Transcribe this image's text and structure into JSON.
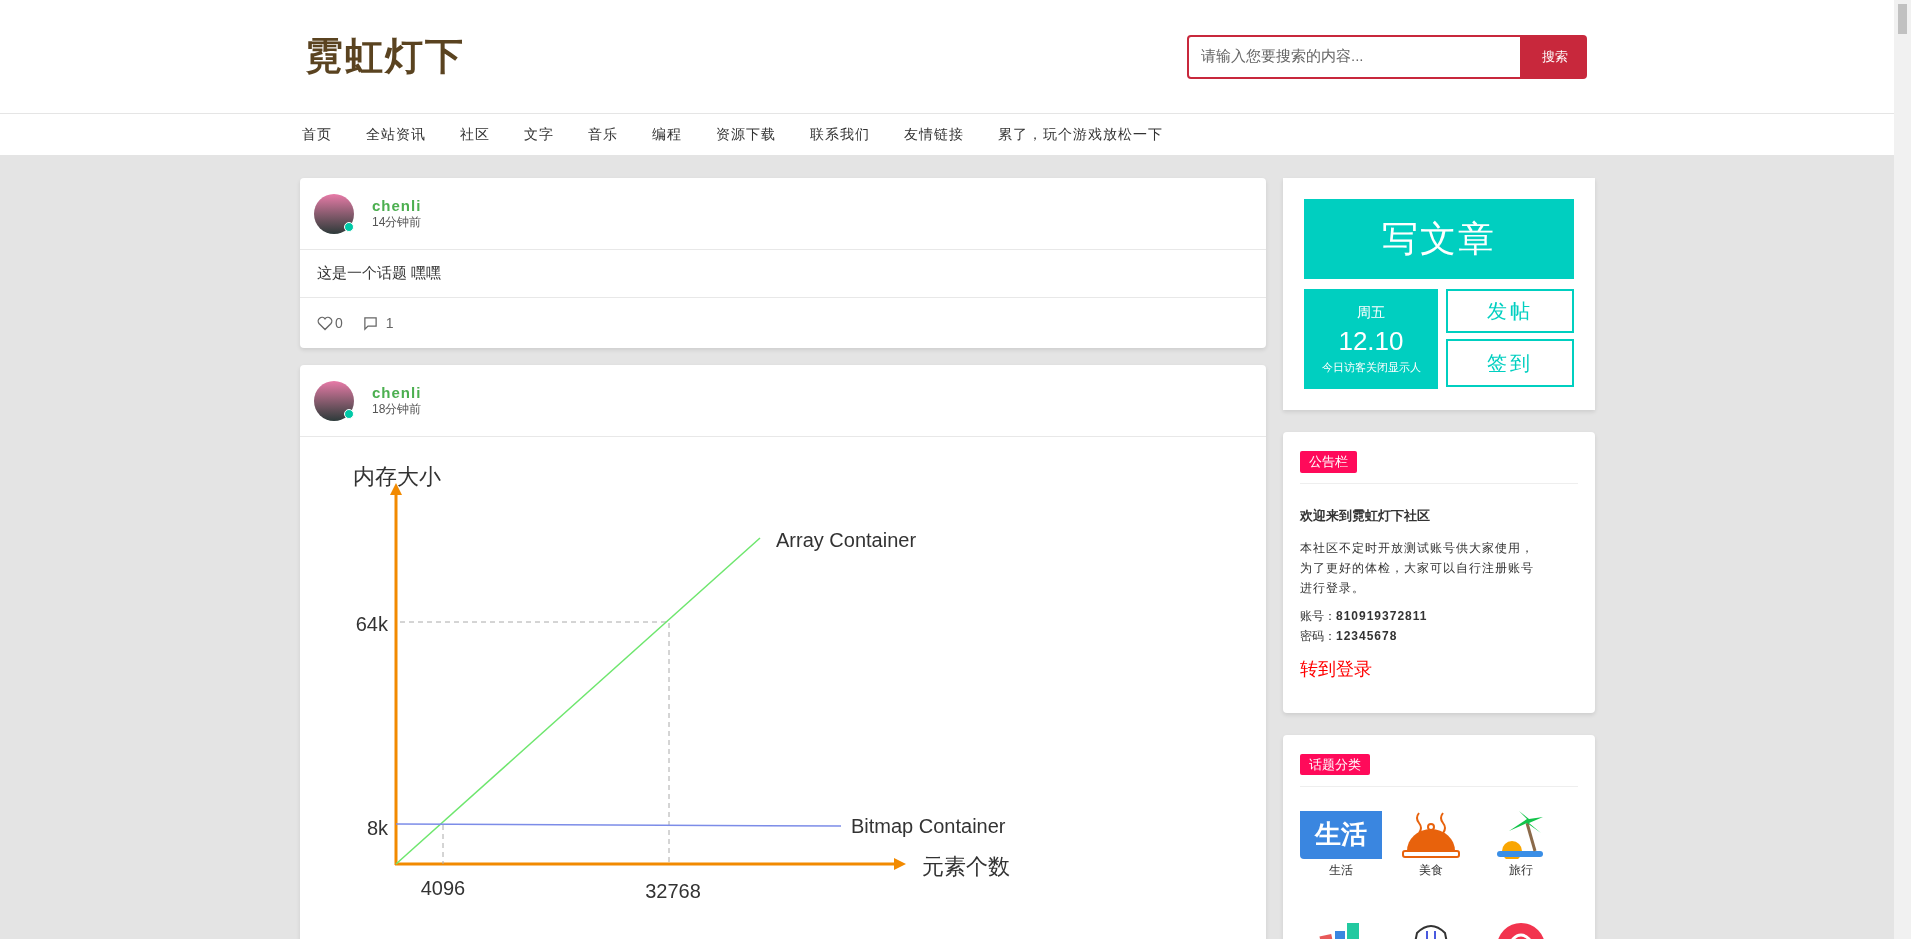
{
  "header": {
    "logo": "霓虹灯下",
    "search": {
      "placeholder": "请输入您要搜索的内容...",
      "button": "搜索"
    }
  },
  "nav": [
    "首页",
    "全站资讯",
    "社区",
    "文字",
    "音乐",
    "编程",
    "资源下载",
    "联系我们",
    "友情链接",
    "累了，玩个游戏放松一下"
  ],
  "posts": [
    {
      "author": "chenli",
      "time": "14分钟前",
      "online": true,
      "text": "这是一个话题 嘿嘿",
      "likes": "0",
      "comments": "1"
    },
    {
      "author": "chenli",
      "time": "18分钟前",
      "online": true,
      "figure": {
        "y_title": "内存大小",
        "x_title": "元素个数",
        "y_ticks": [
          "64k",
          "8k"
        ],
        "x_ticks": [
          "4096",
          "32768"
        ],
        "lines": [
          "Array Container",
          "Bitmap Container"
        ]
      }
    }
  ],
  "sidebar": {
    "actions": {
      "write": "写文章",
      "weekday": "周五",
      "date": "12.10",
      "visitors": "今日访客关闭显示人",
      "post": "发帖",
      "checkin": "签到"
    },
    "notice": {
      "tag": "公告栏",
      "title": "欢迎来到霓虹灯下社区",
      "body": "本社区不定时开放测试账号供大家使用，为了更好的体检，大家可以自行注册账号进行登录。",
      "account_label": "账号：",
      "account": "810919372811",
      "password_label": "密码：",
      "password": "12345678",
      "login": "转到登录"
    },
    "categories": {
      "tag": "话题分类",
      "items": [
        {
          "kind": "life",
          "label": "生活",
          "icon_text": "生活"
        },
        {
          "kind": "food",
          "label": "美食"
        },
        {
          "kind": "travel",
          "label": "旅行"
        },
        {
          "kind": "books"
        },
        {
          "kind": "clothing"
        },
        {
          "kind": "pet"
        }
      ]
    }
  }
}
